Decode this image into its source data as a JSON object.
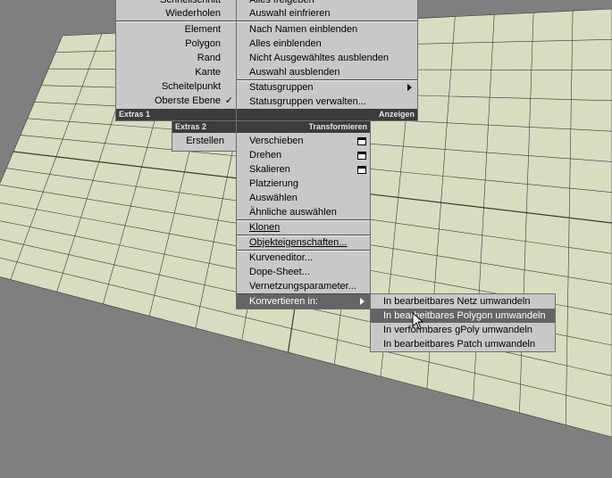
{
  "colors": {
    "viewport_bg": "#7f7f7f",
    "grid_fill": "#d8dcc0",
    "grid_line": "#3a3a3a",
    "menu_bg": "#c8c8c8",
    "header_bg": "#3c3c3c",
    "highlight_bg": "#646464"
  },
  "extras1": {
    "header": "Extras 1",
    "items": [
      {
        "label": "Schnellschnitt"
      },
      {
        "label": "Wiederholen"
      },
      {
        "label": "Element"
      },
      {
        "label": "Polygon"
      },
      {
        "label": "Rand"
      },
      {
        "label": "Kante"
      },
      {
        "label": "Scheitelpunkt"
      },
      {
        "label": "Oberste Ebene",
        "checked": true,
        "check_mark": "✓"
      }
    ]
  },
  "anzeigen": {
    "header": "Anzeigen",
    "items": [
      {
        "label": "Alles freigeben"
      },
      {
        "label": "Auswahl einfrieren"
      },
      {
        "label": "Nach Namen einblenden"
      },
      {
        "label": "Alles einblenden"
      },
      {
        "label": "Nicht Ausgewähltes ausblenden"
      },
      {
        "label": "Auswahl ausblenden"
      },
      {
        "label": "Statusgruppen",
        "submenu": true
      },
      {
        "label": "Statusgruppen verwalten..."
      }
    ]
  },
  "extras2": {
    "header": "Extras 2",
    "items": [
      {
        "label": "Erstellen"
      }
    ]
  },
  "transformieren": {
    "header": "Transformieren",
    "items": [
      {
        "label": "Verschieben",
        "options": true
      },
      {
        "label": "Drehen",
        "options": true
      },
      {
        "label": "Skalieren",
        "options": true
      },
      {
        "label": "Platzierung"
      },
      {
        "label": "Auswählen"
      },
      {
        "label": "Ähnliche auswählen"
      },
      {
        "label": "Klonen"
      },
      {
        "label": "Objekteigenschaften..."
      },
      {
        "label": "Kurveneditor..."
      },
      {
        "label": "Dope-Sheet..."
      },
      {
        "label": "Vernetzungsparameter..."
      },
      {
        "label": "Konvertieren in:",
        "submenu": true,
        "active": true
      }
    ]
  },
  "convert_submenu": {
    "items": [
      {
        "label": "In bearbeitbares Netz umwandeln"
      },
      {
        "label": "In bearbeitbares Polygon umwandeln",
        "highlighted": true
      },
      {
        "label": "In verformbares gPoly umwandeln"
      },
      {
        "label": "In bearbeitbares Patch umwandeln"
      }
    ]
  }
}
